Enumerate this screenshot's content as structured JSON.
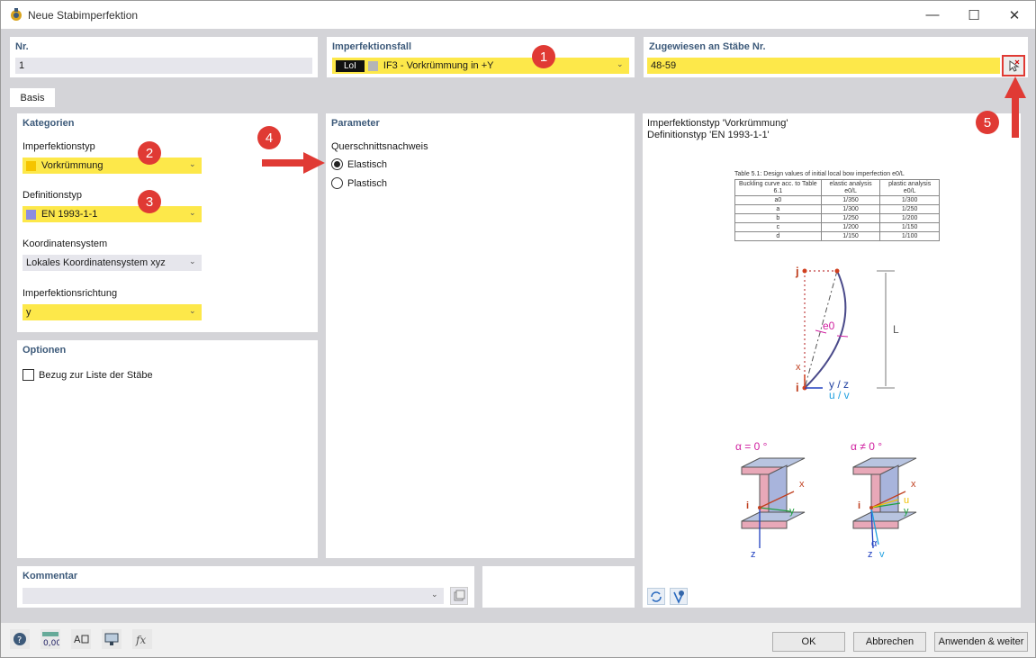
{
  "window": {
    "title": "Neue Stabimperfektion"
  },
  "nr": {
    "title": "Nr.",
    "value": "1"
  },
  "imperfektionsfall": {
    "title": "Imperfektionsfall",
    "tag": "LoI",
    "value": "IF3 - Vorkrümmung in +Y"
  },
  "zugewiesen": {
    "title": "Zugewiesen an Stäbe Nr.",
    "value": "48-59"
  },
  "tabs": [
    {
      "label": "Basis"
    }
  ],
  "kategorien": {
    "title": "Kategorien",
    "imperfektionstyp": {
      "label": "Imperfektionstyp",
      "value": "Vorkrümmung",
      "color": "#f5c400"
    },
    "definitionstyp": {
      "label": "Definitionstyp",
      "value": "EN 1993-1-1",
      "color": "#8c8ce0"
    },
    "koordinatensystem": {
      "label": "Koordinatensystem",
      "value": "Lokales Koordinatensystem xyz"
    },
    "richtung": {
      "label": "Imperfektionsrichtung",
      "value": "y"
    }
  },
  "optionen": {
    "title": "Optionen",
    "bezug": "Bezug zur Liste der Stäbe"
  },
  "parameter": {
    "title": "Parameter",
    "nachweis_label": "Querschnittsnachweis",
    "options": [
      "Elastisch",
      "Plastisch"
    ]
  },
  "info": {
    "line1": "Imperfektionstyp 'Vorkrümmung'",
    "line2": "Definitionstyp 'EN 1993-1-1'",
    "table_caption": "Table 5.1: Design values of initial local bow imperfection e0/L",
    "table_headers": [
      "Buckling curve acc. to Table 6.1",
      "elastic analysis e0/L",
      "plastic analysis e0/L"
    ],
    "table_rows": [
      [
        "a0",
        "1/350",
        "1/300"
      ],
      [
        "a",
        "1/300",
        "1/250"
      ],
      [
        "b",
        "1/250",
        "1/200"
      ],
      [
        "c",
        "1/200",
        "1/150"
      ],
      [
        "d",
        "1/150",
        "1/100"
      ]
    ],
    "diagram": {
      "j": "j",
      "i": "i",
      "x": "x",
      "e0": "e0",
      "L": "L",
      "yz": "y / z",
      "uv": "u / v"
    },
    "alpha0": "α = 0 °",
    "alphaNot0": "α ≠ 0 °",
    "sec_x": "x",
    "sec_y": "y",
    "sec_z": "z",
    "sec_i": "i",
    "sec_u": "u",
    "sec_v": "v",
    "sec_alpha": "α"
  },
  "kommentar": {
    "title": "Kommentar",
    "value": ""
  },
  "badges": [
    "1",
    "2",
    "3",
    "4",
    "5"
  ],
  "buttons": {
    "ok": "OK",
    "cancel": "Abbrechen",
    "apply": "Anwenden & weiter"
  },
  "colors": {
    "highlight": "#fde84a",
    "badge": "#e03a34",
    "title_blue": "#3d5a7a"
  }
}
